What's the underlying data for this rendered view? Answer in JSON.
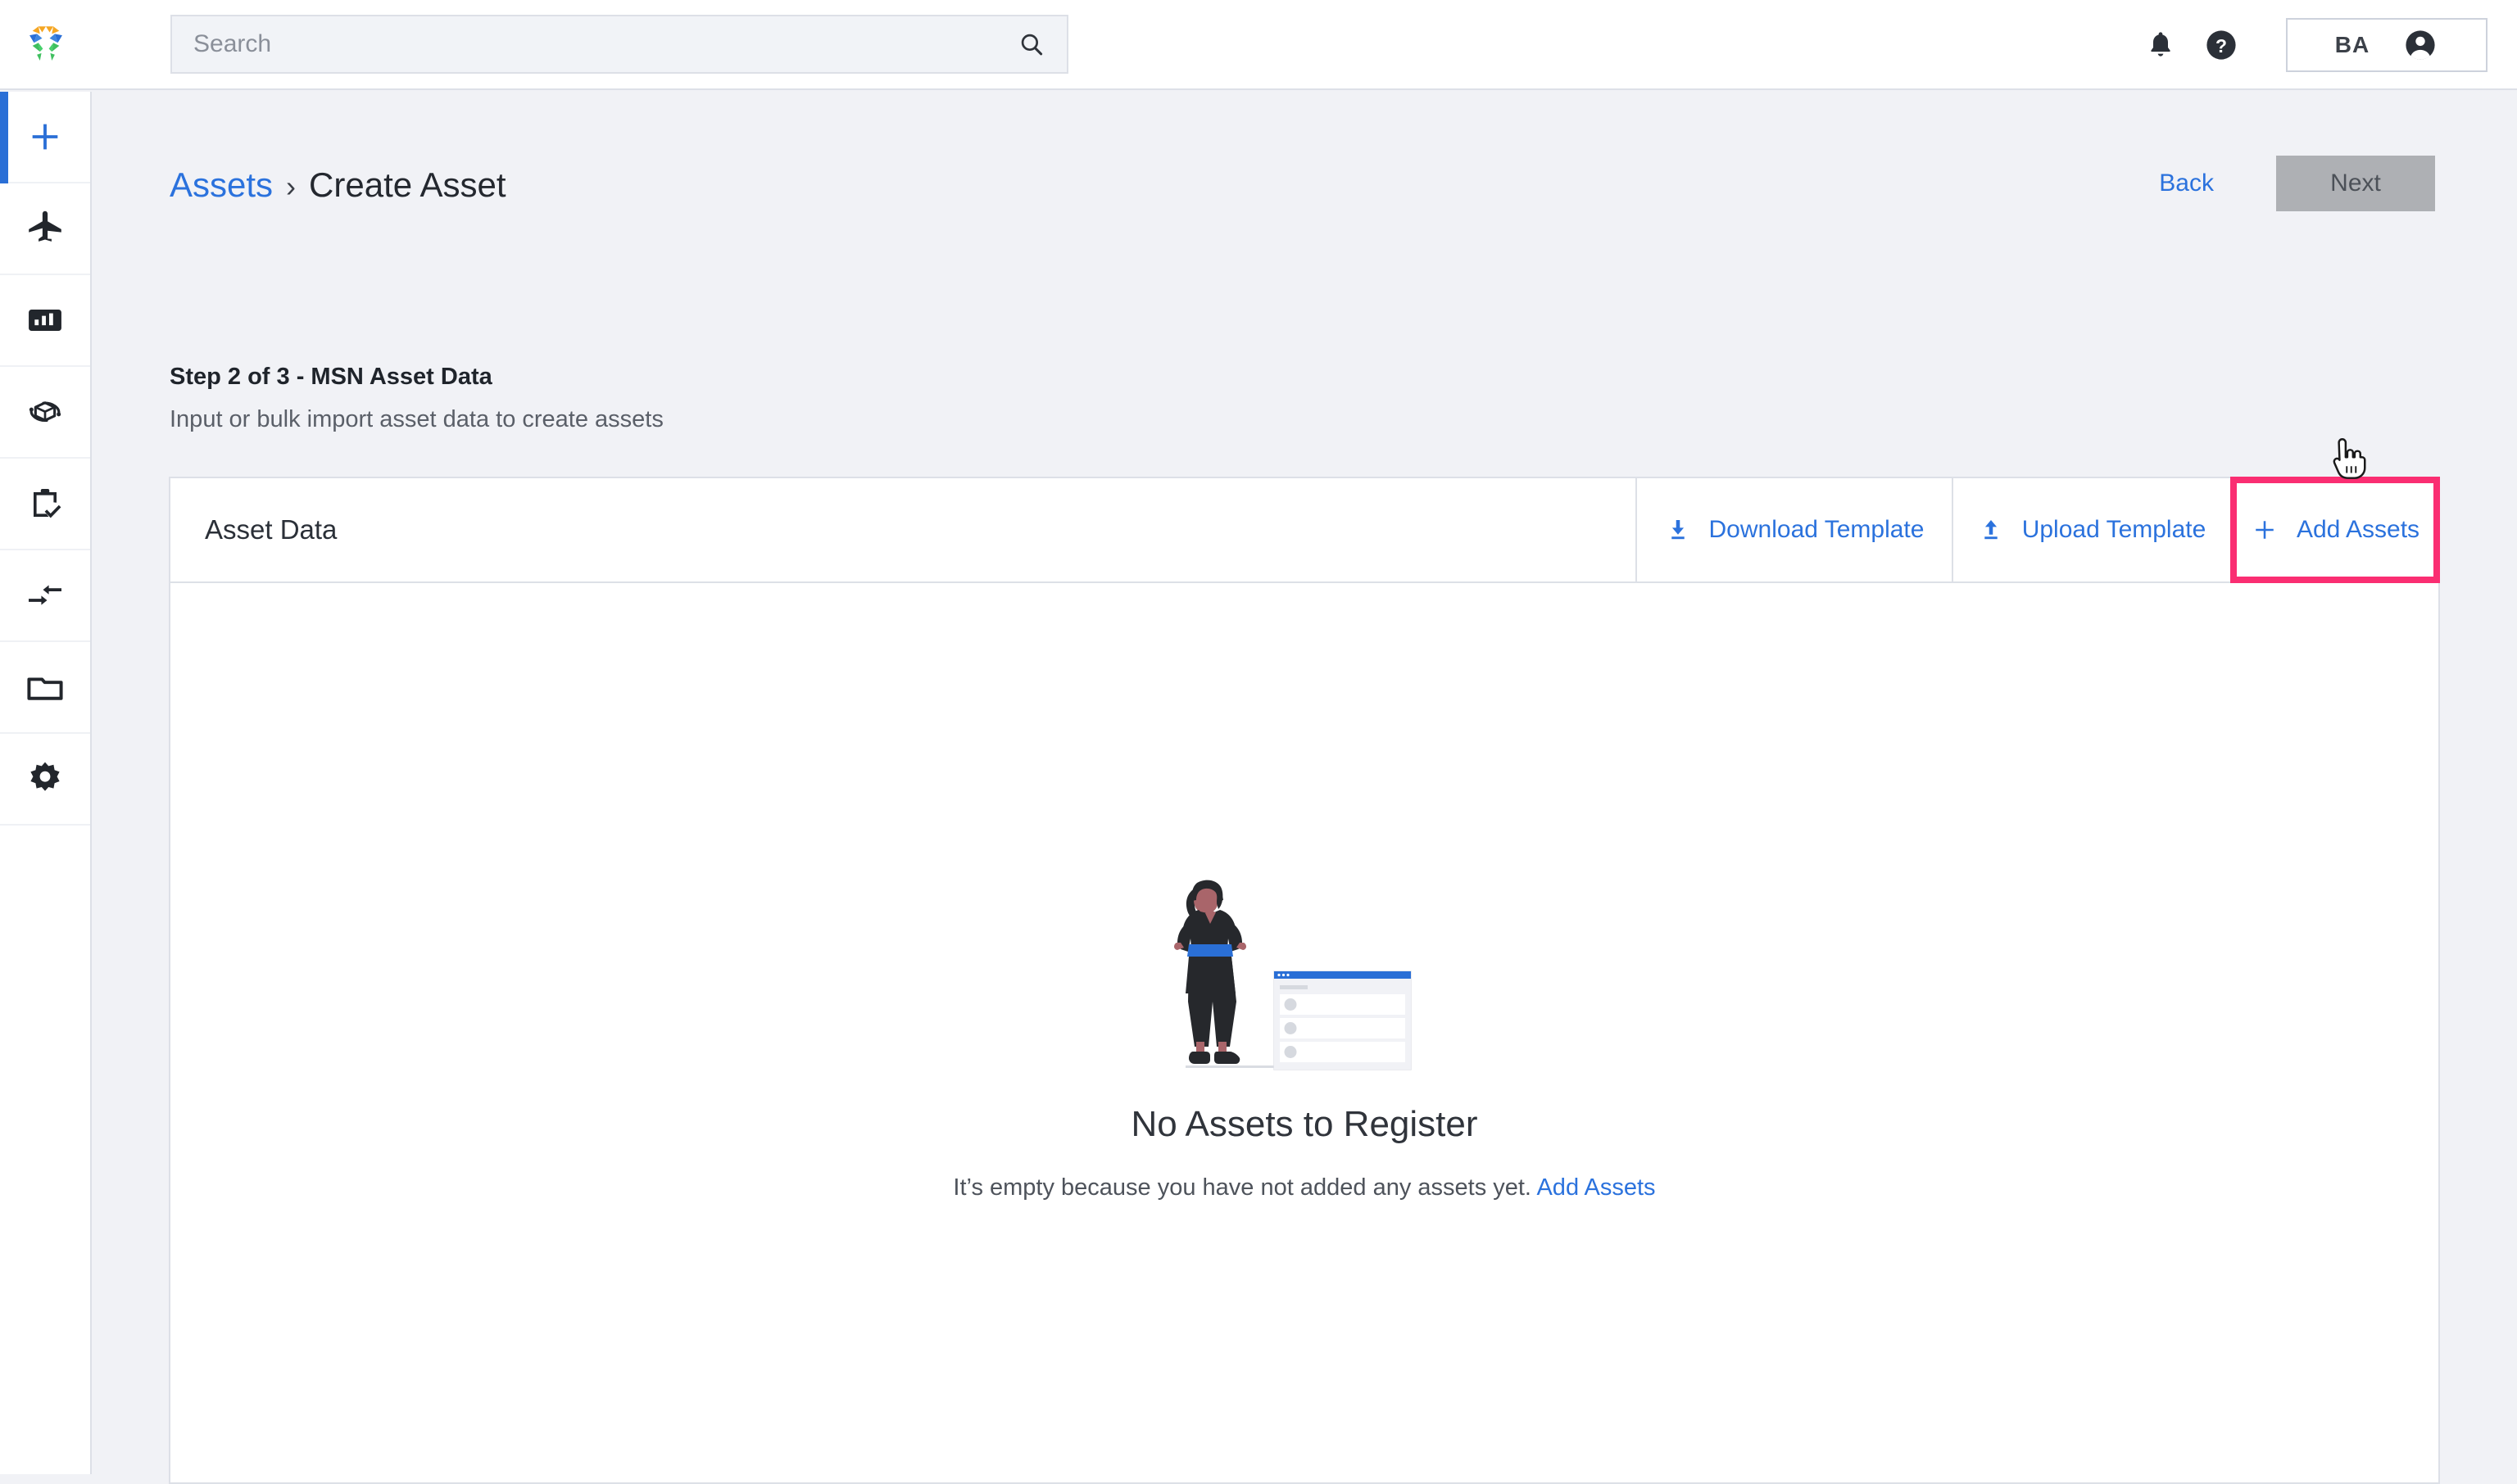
{
  "app": {
    "logo_icon": "hexagon-logo-icon",
    "brand_colors": {
      "orange": "#F5A623",
      "blue": "#2A6FD6",
      "green": "#3FBF5F"
    }
  },
  "topbar": {
    "search": {
      "placeholder": "Search",
      "value": "",
      "icon": "search-icon"
    },
    "notifications_icon": "bell-icon",
    "help_icon": "help-circle-icon",
    "user": {
      "initials": "BA",
      "avatar_icon": "account-circle-icon"
    }
  },
  "sidebar": {
    "items": [
      {
        "name": "add",
        "icon": "plus-icon",
        "active": true
      },
      {
        "name": "flights",
        "icon": "airplane-icon",
        "active": false
      },
      {
        "name": "reports",
        "icon": "bar-chart-icon",
        "active": false
      },
      {
        "name": "rotables",
        "icon": "package-rotate-icon",
        "active": false
      },
      {
        "name": "tasks",
        "icon": "clipboard-check-icon",
        "active": false
      },
      {
        "name": "transfers",
        "icon": "transfer-arrows-icon",
        "active": false
      },
      {
        "name": "folders",
        "icon": "folder-icon",
        "active": false
      },
      {
        "name": "settings",
        "icon": "gear-icon",
        "active": false
      }
    ]
  },
  "header": {
    "breadcrumb_parent": "Assets",
    "breadcrumb_separator": "›",
    "breadcrumb_current": "Create Asset",
    "back_label": "Back",
    "next_label": "Next",
    "next_disabled": true
  },
  "step": {
    "title": "Step 2 of 3 - MSN Asset Data",
    "subtitle": "Input or bulk import asset data to create assets"
  },
  "card": {
    "title": "Asset Data",
    "actions": [
      {
        "label": "Download Template",
        "icon": "download-icon",
        "highlighted": false
      },
      {
        "label": "Upload Template",
        "icon": "upload-icon",
        "highlighted": false
      },
      {
        "label": "Add Assets",
        "icon": "plus-icon",
        "highlighted": true
      }
    ],
    "highlight_color": "#FA2E72"
  },
  "empty_state": {
    "illustration": "woman-with-empty-list-illustration",
    "title": "No Assets to Register",
    "message_prefix": "It’s empty because you have not added any assets yet.",
    "link_label": "Add Assets"
  },
  "cursor": {
    "icon": "pointing-hand-cursor"
  }
}
